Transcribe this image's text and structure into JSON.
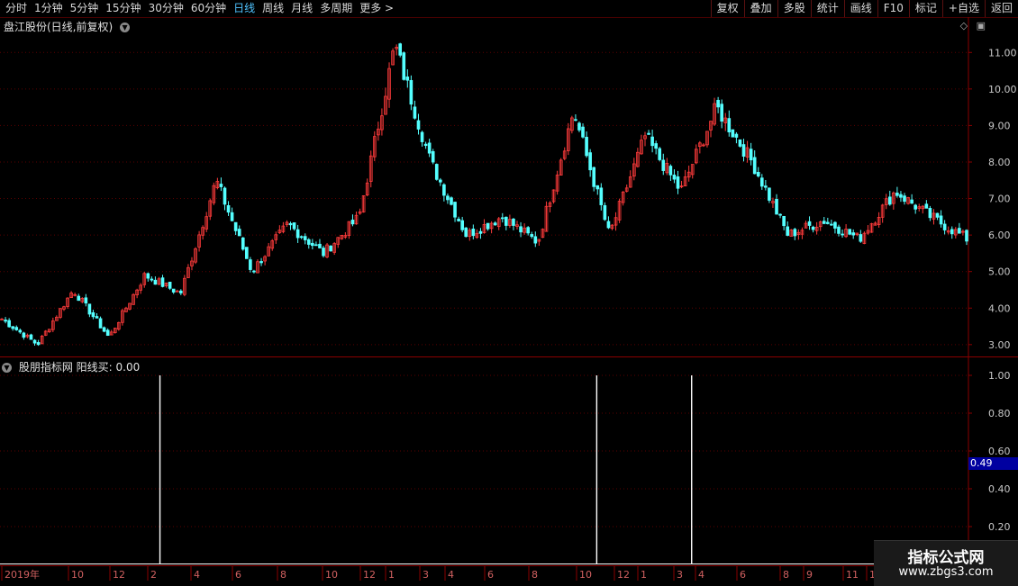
{
  "toolbar": {
    "periods": [
      "分时",
      "1分钟",
      "5分钟",
      "15分钟",
      "30分钟",
      "60分钟",
      "日线",
      "周线",
      "月线",
      "多周期",
      "更多 >"
    ],
    "active_period": "日线",
    "tools": [
      "复权",
      "叠加",
      "多股",
      "统计",
      "画线",
      "F10",
      "标记",
      "+自选",
      "返回"
    ]
  },
  "main_chart": {
    "title": "盘江股份(日线,前复权)",
    "price_axis": [
      "11.00",
      "10.00",
      "9.00",
      "8.00",
      "7.00",
      "6.00",
      "5.00",
      "4.00",
      "3.00"
    ],
    "up_color": "#ff3b3b",
    "down_color": "#54ffff"
  },
  "indicator": {
    "name": "股朋指标网",
    "series_label": "阳线买: 0.00",
    "axis": [
      "1.00",
      "0.80",
      "0.60",
      "0.40",
      "0.20"
    ],
    "current_tag": "0.49"
  },
  "date_axis": [
    "2019年",
    "10",
    "12",
    "2",
    "4",
    "6",
    "8",
    "10",
    "12",
    "1",
    "3",
    "4",
    "6",
    "8",
    "10",
    "12",
    "1",
    "3",
    "4",
    "6",
    "8",
    "9",
    "11",
    "12"
  ],
  "watermark": {
    "line1": "指标公式网",
    "line2": "www.zbgs3.com"
  },
  "chart_data": {
    "type": "candlestick",
    "title": "盘江股份(日线,前复权)",
    "ylim": [
      2.7,
      11.5
    ],
    "key_prices": [
      3.7,
      3.0,
      4.5,
      3.2,
      4.9,
      4.4,
      7.5,
      5.0,
      6.3,
      5.5,
      6.5,
      11.2,
      8.0,
      6.0,
      6.5,
      5.8,
      9.4,
      6.0,
      8.7,
      7.2,
      9.5,
      8.0,
      6.0,
      6.4,
      5.9,
      7.2,
      6.5,
      5.9
    ],
    "indicator_signals_x_fraction": [
      0.154,
      0.605,
      0.703
    ],
    "indicator_signal_value": 1.0
  }
}
